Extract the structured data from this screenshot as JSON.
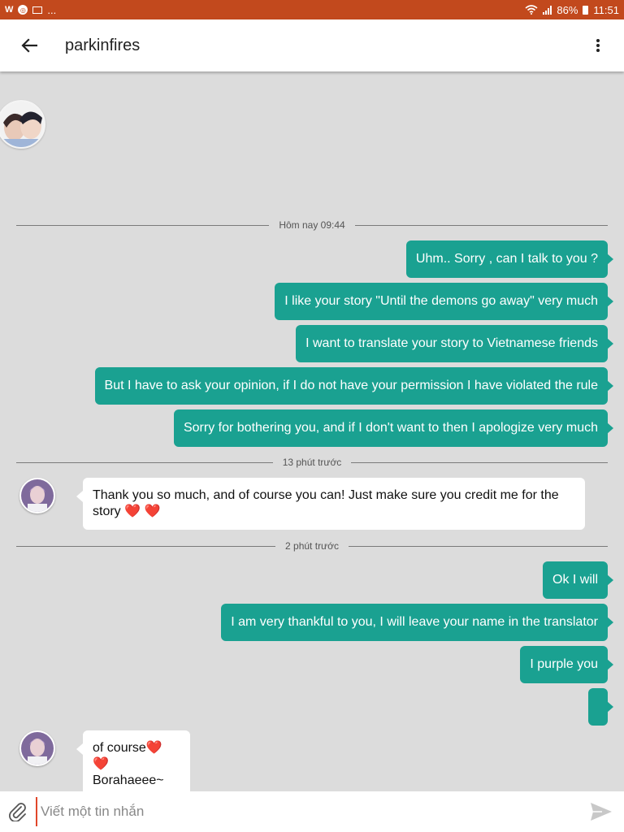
{
  "status_bar": {
    "left_glyph": "W",
    "ellipsis": "...",
    "battery": "86%",
    "time": "11:51"
  },
  "header": {
    "title": "parkinfires"
  },
  "separators": [
    "Hôm nay 09:44",
    "13 phút trước",
    "2 phút trước"
  ],
  "messages_out_1": [
    "Uhm.. Sorry , can I talk to you ?",
    "I like your story \"Until the demons go away\" very much",
    "I want to translate your story to Vietnamese friends",
    "But I have to ask your opinion, if I do not have your permission I have violated the rule",
    "Sorry for bothering you, and if I don't want to then I apologize very much"
  ],
  "message_in_1": {
    "line1": "Thank you so much, and of course you can! Just make sure you credit me for the",
    "line2": "story ❤️ ❤️"
  },
  "messages_out_2": [
    "Ok I will",
    "I am very thankful to you, I will leave your name in the translator",
    "I purple you",
    ""
  ],
  "message_in_2": {
    "line1": "of course❤️ ❤️",
    "line2": "Borahaeee~"
  },
  "composer": {
    "placeholder": "Viết một tin nhắn"
  },
  "colors": {
    "status_bar": "#c2491d",
    "outgoing_bubble": "#1aa191",
    "background": "#dcdcdc"
  }
}
